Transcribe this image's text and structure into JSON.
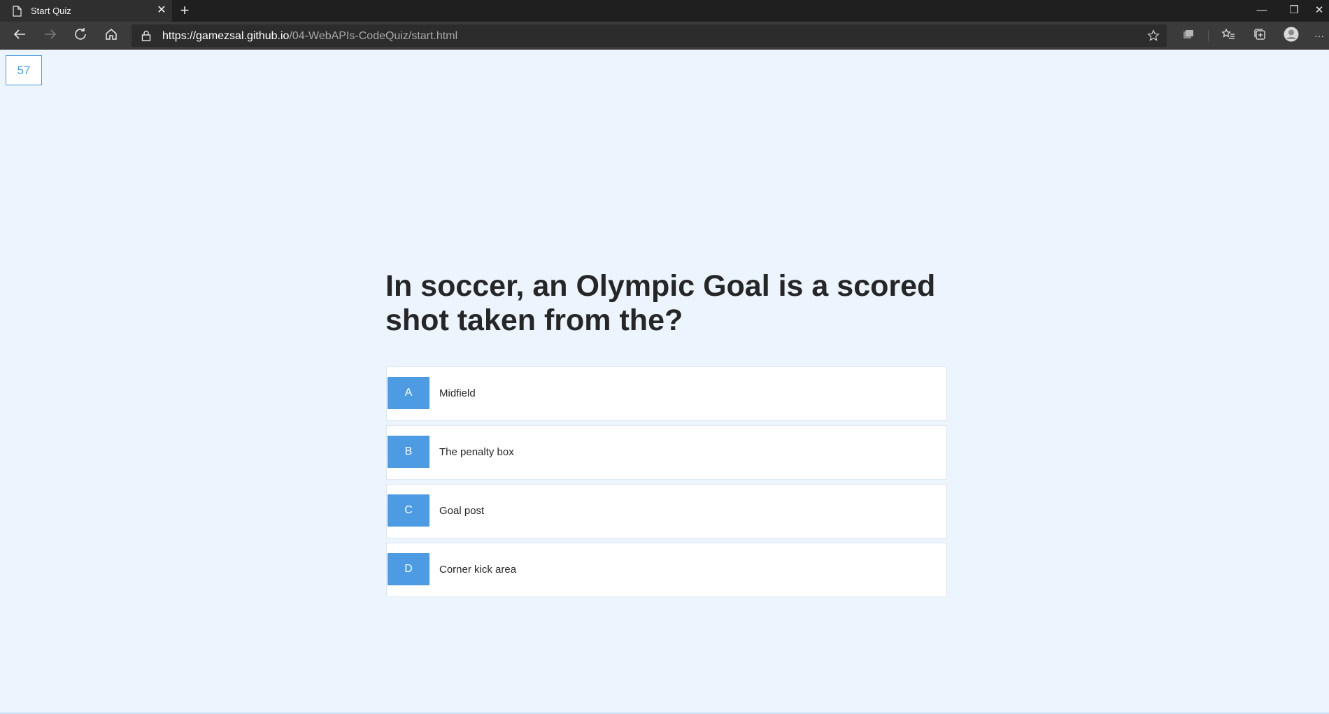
{
  "browser": {
    "tab_title": "Start Quiz",
    "tab_close": "✕",
    "new_tab": "+",
    "url_host": "https://gamezsal.github.io",
    "url_path": "/04-WebAPIs-CodeQuiz/start.html",
    "window_controls": {
      "minimize": "—",
      "restore": "❐",
      "close": "✕"
    },
    "menu": "···"
  },
  "quiz": {
    "timer": "57",
    "question": "In soccer, an Olympic Goal is a scored shot taken from the?",
    "choices": [
      {
        "prefix": "A",
        "text": "Midfield"
      },
      {
        "prefix": "B",
        "text": "The penalty box"
      },
      {
        "prefix": "C",
        "text": "Goal post"
      },
      {
        "prefix": "D",
        "text": "Corner kick area"
      }
    ]
  },
  "colors": {
    "accent": "#4d9be3",
    "page_background": "#ecf4fe",
    "chrome_dark": "#3b3b3b"
  }
}
